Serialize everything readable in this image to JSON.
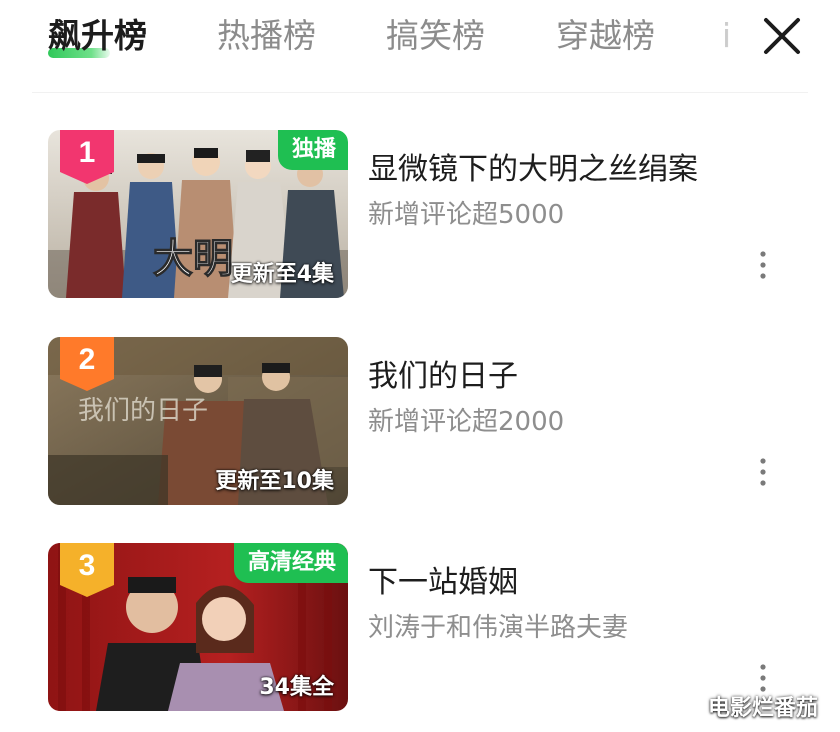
{
  "tabs": {
    "items": [
      {
        "label": "飙升榜",
        "active": true
      },
      {
        "label": "热播榜",
        "active": false
      },
      {
        "label": "搞笑榜",
        "active": false
      },
      {
        "label": "穿越榜",
        "active": false
      },
      {
        "label": "i",
        "active": false
      }
    ],
    "close_icon": "close-icon"
  },
  "list": {
    "items": [
      {
        "rank": "1",
        "rank_color": "#f2366f",
        "badge": "独播",
        "episodes": "更新至4集",
        "title": "显微镜下的大明之丝绢案",
        "subtitle": "新增评论超5000",
        "poster_text": "大明"
      },
      {
        "rank": "2",
        "rank_color": "#ff7a2a",
        "badge": "",
        "episodes": "更新至10集",
        "title": "我们的日子",
        "subtitle": "新增评论超2000",
        "poster_text": "我们的日子"
      },
      {
        "rank": "3",
        "rank_color": "#f5b12a",
        "badge": "高清经典",
        "episodes": "34集全",
        "title": "下一站婚姻",
        "subtitle": "刘涛于和伟演半路夫妻",
        "poster_text": ""
      }
    ]
  },
  "watermark": "电影烂番茄",
  "colors": {
    "accent": "#1fbf52",
    "title": "#1d1d1d",
    "muted": "#8e8e8e"
  }
}
